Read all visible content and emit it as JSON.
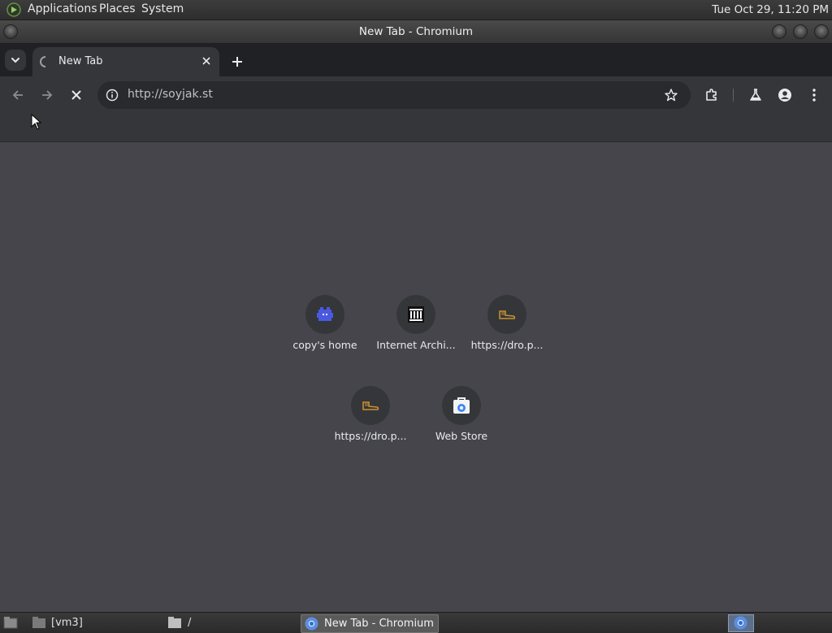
{
  "top_panel": {
    "menus": [
      "Applications",
      "Places",
      "System"
    ],
    "clock": "Tue Oct 29, 11:20 PM"
  },
  "window": {
    "title": "New Tab - Chromium"
  },
  "tab": {
    "title": "New Tab"
  },
  "omnibox": {
    "url": "http://soyjak.st"
  },
  "shortcuts": [
    {
      "label": "copy's home",
      "icon": "blue-ghost-icon"
    },
    {
      "label": "Internet Archi...",
      "icon": "archive-building-icon"
    },
    {
      "label": "https://dro.p...",
      "icon": "boot-icon"
    },
    {
      "label": "https://dro.p...",
      "icon": "boot-icon"
    },
    {
      "label": "Web Store",
      "icon": "web-store-icon"
    }
  ],
  "taskbar": {
    "items": [
      "[vm3]",
      "/",
      "New Tab - Chromium"
    ]
  },
  "colors": {
    "content_bg": "#45454b",
    "toolbar_bg": "#35363a",
    "tabstrip_bg": "#202124",
    "accent_blue": "#5b6ee8"
  }
}
